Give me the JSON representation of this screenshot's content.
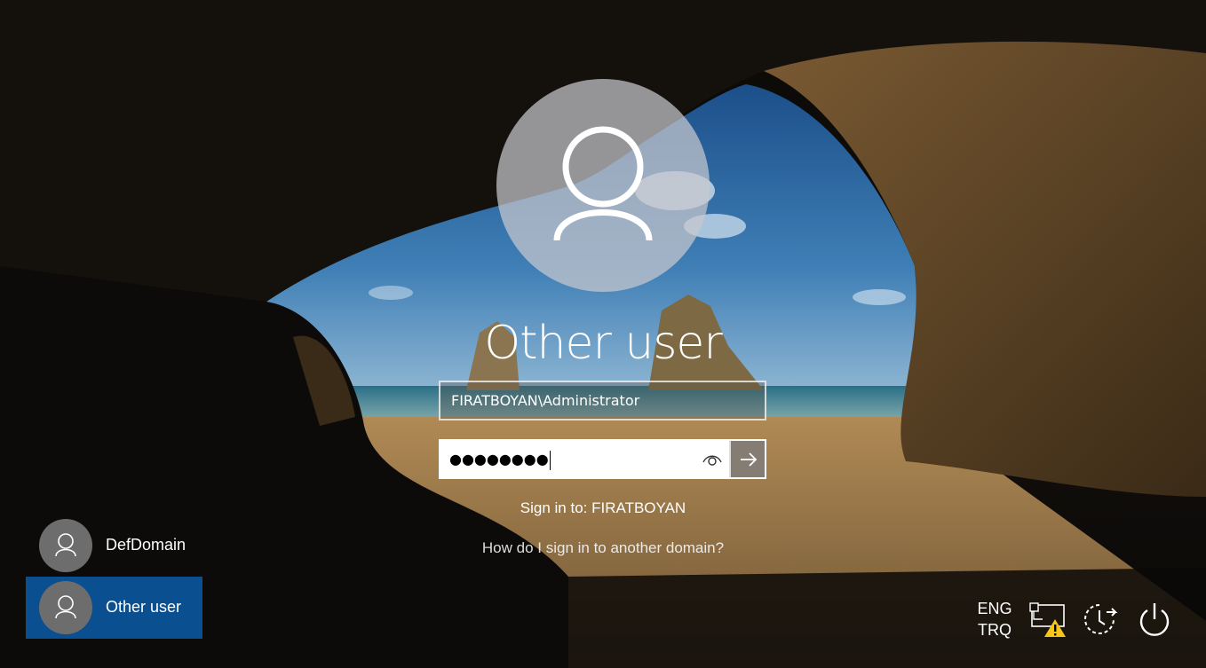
{
  "login": {
    "title": "Other user",
    "username_value": "FIRATBOYAN\\Administrator",
    "password_masked": "●●●●●●●●",
    "sign_in_to": "Sign in to: FIRATBOYAN",
    "other_domain_link": "How do I sign in to another domain?"
  },
  "users": [
    {
      "label": "DefDomain",
      "selected": false
    },
    {
      "label": "Other user",
      "selected": true
    }
  ],
  "tray": {
    "language_line1": "ENG",
    "language_line2": "TRQ",
    "network_icon": "network-warning-icon",
    "ease_icon": "ease-of-access-icon",
    "power_icon": "power-icon"
  },
  "colors": {
    "selected_tile": "#0a4f8f",
    "warning": "#f5c518"
  }
}
